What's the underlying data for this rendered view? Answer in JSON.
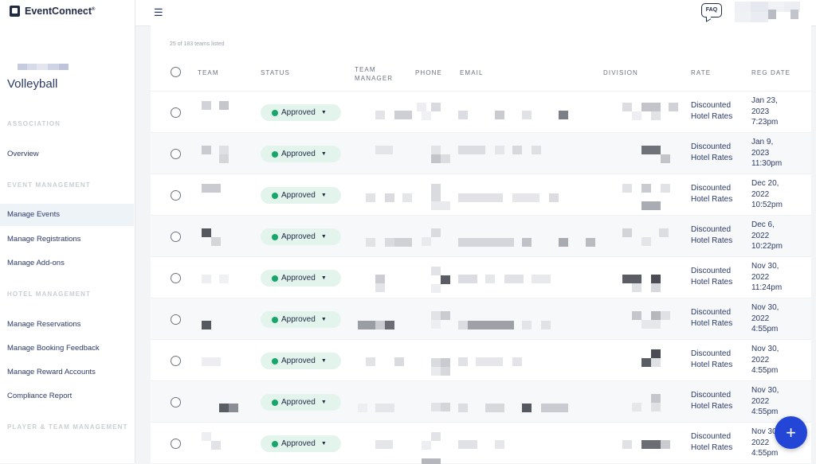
{
  "brand": {
    "name": "EventConnect",
    "trademark": "®"
  },
  "event": {
    "title": "Volleyball"
  },
  "sidebar": {
    "sections": [
      {
        "label": "ASSOCIATION"
      },
      {
        "label": "EVENT MANAGEMENT"
      },
      {
        "label": "HOTEL MANAGEMENT"
      },
      {
        "label": "PLAYER & TEAM MANAGEMENT"
      }
    ],
    "items": [
      {
        "label": "Overview"
      },
      {
        "label": "Manage Events"
      },
      {
        "label": "Manage Registrations"
      },
      {
        "label": "Manage Add-ons"
      },
      {
        "label": "Manage Reservations"
      },
      {
        "label": "Manage Booking Feedback"
      },
      {
        "label": "Manage Reward Accounts"
      },
      {
        "label": "Compliance Report"
      }
    ],
    "active_item": "Manage Events"
  },
  "topbar": {
    "menu_icon": "hamburger-icon",
    "faq_label": "FAQ"
  },
  "table": {
    "count_text": "25 of 183 teams listed",
    "columns": [
      "TEAM",
      "STATUS",
      "TEAM MANAGER",
      "PHONE",
      "EMAIL",
      "DIVISION",
      "RATE",
      "REG DATE"
    ],
    "rows": [
      {
        "status": "Approved",
        "rate": [
          "Discounted",
          "Hotel Rates"
        ],
        "reg_date": [
          "Jan 23,",
          "2023",
          "7:23pm"
        ]
      },
      {
        "status": "Approved",
        "rate": [
          "Discounted",
          "Hotel Rates"
        ],
        "reg_date": [
          "Jan 9,",
          "2023",
          "11:30pm"
        ]
      },
      {
        "status": "Approved",
        "rate": [
          "Discounted",
          "Hotel Rates"
        ],
        "reg_date": [
          "Dec 20,",
          "2022",
          "10:52pm"
        ]
      },
      {
        "status": "Approved",
        "rate": [
          "Discounted",
          "Hotel Rates"
        ],
        "reg_date": [
          "Dec 6,",
          "2022",
          "10:22pm"
        ]
      },
      {
        "status": "Approved",
        "rate": [
          "Discounted",
          "Hotel Rates"
        ],
        "reg_date": [
          "Nov 30,",
          "2022",
          "11:24pm"
        ]
      },
      {
        "status": "Approved",
        "rate": [
          "Discounted",
          "Hotel Rates"
        ],
        "reg_date": [
          "Nov 30,",
          "2022",
          "4:55pm"
        ]
      },
      {
        "status": "Approved",
        "rate": [
          "Discounted",
          "Hotel Rates"
        ],
        "reg_date": [
          "Nov 30,",
          "2022",
          "4:55pm"
        ]
      },
      {
        "status": "Approved",
        "rate": [
          "Discounted",
          "Hotel Rates"
        ],
        "reg_date": [
          "Nov 30,",
          "2022",
          "4:55pm"
        ]
      },
      {
        "status": "Approved",
        "rate": [
          "Discounted",
          "Hotel Rates"
        ],
        "reg_date": [
          "Nov 30,",
          "2022",
          "4:55pm"
        ]
      }
    ]
  },
  "fab": {
    "label": "+"
  },
  "colors": {
    "status_dot": "#18a56b",
    "status_bg": "#e3f4ec",
    "fab": "#2346d6",
    "text": "#2b3a67"
  }
}
